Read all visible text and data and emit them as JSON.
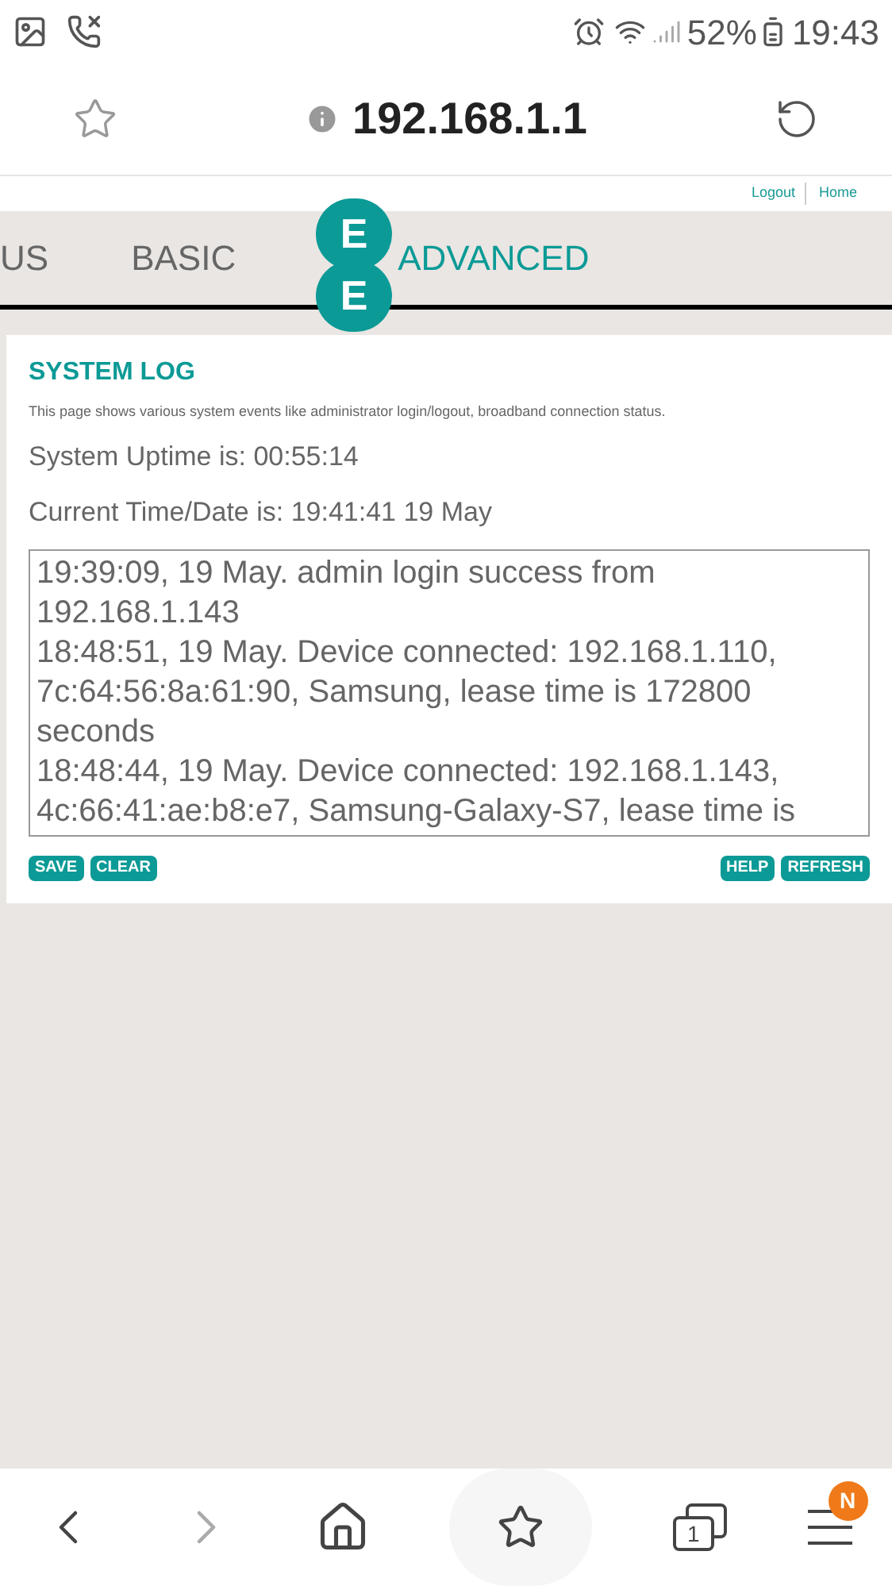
{
  "status_bar": {
    "battery": "52%",
    "time": "19:43"
  },
  "address_bar": {
    "url": "192.168.1.1"
  },
  "top_links": [
    "Logout",
    "Home"
  ],
  "nav_tabs": [
    {
      "label": "US",
      "selected": false
    },
    {
      "label": "BASIC",
      "selected": false
    },
    {
      "label": "ADVANCED",
      "selected": true
    }
  ],
  "logo_letters": [
    "E",
    "E"
  ],
  "panel": {
    "title": "SYSTEM LOG",
    "description": "This page shows various system events like administrator login/logout, broadband connection status.",
    "uptime": "System Uptime is: 00:55:14",
    "current_time": "Current Time/Date is: 19:41:41 19 May",
    "log_entries": [
      "19:39:09, 19 May. admin login success from 192.168.1.143",
      "18:48:51, 19 May. Device connected: 192.168.1.110, 7c:64:56:8a:61:90, Samsung, lease time is 172800 seconds",
      "18:48:44, 19 May. Device connected: 192.168.1.143, 4c:66:41:ae:b8:e7, Samsung-Galaxy-S7, lease time is"
    ],
    "left_buttons": [
      "SAVE",
      "CLEAR"
    ],
    "right_buttons": [
      "HELP",
      "REFRESH"
    ]
  },
  "bottom_nav": {
    "tab_count": "1",
    "menu_badge": "N"
  }
}
